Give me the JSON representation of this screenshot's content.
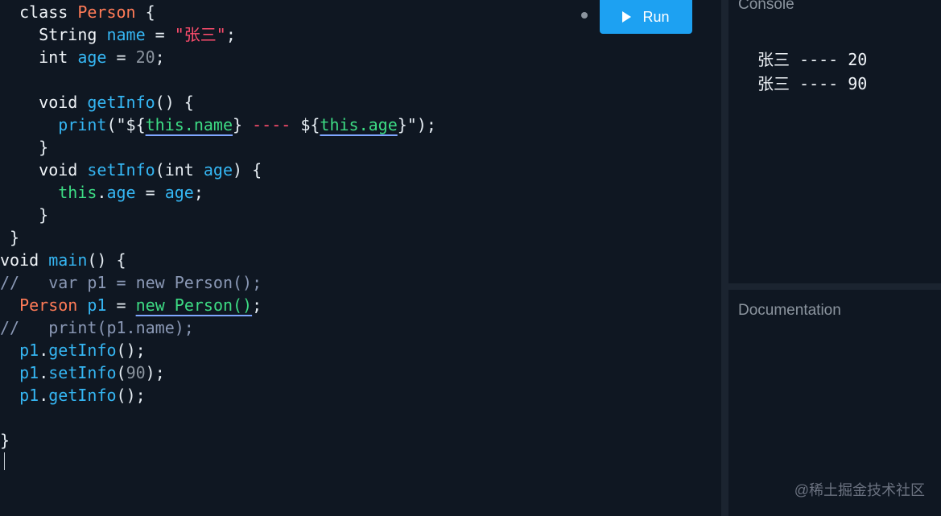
{
  "editor": {
    "lines": [
      [
        [
          "  class ",
          "kw"
        ],
        [
          "Person",
          "cls"
        ],
        [
          " {",
          "pn"
        ]
      ],
      [
        [
          "    String ",
          "kw"
        ],
        [
          "name",
          "id"
        ],
        [
          " = ",
          "pn"
        ],
        [
          "\"张三\"",
          "str"
        ],
        [
          ";",
          "pn"
        ]
      ],
      [
        [
          "    int ",
          "kw"
        ],
        [
          "age",
          "id"
        ],
        [
          " = ",
          "pn"
        ],
        [
          "20",
          "num"
        ],
        [
          ";",
          "pn"
        ]
      ],
      [
        [
          "",
          "pn"
        ]
      ],
      [
        [
          "    void ",
          "kw"
        ],
        [
          "getInfo",
          "id"
        ],
        [
          "() {",
          "pn"
        ]
      ],
      [
        [
          "      ",
          "pn"
        ],
        [
          "print",
          "id"
        ],
        [
          "(\"${",
          "pn"
        ],
        [
          "this.name",
          "th ul"
        ],
        [
          "} ",
          "pn"
        ],
        [
          "----",
          "str"
        ],
        [
          " ${",
          "pn"
        ],
        [
          "this.age",
          "th ul"
        ],
        [
          "}\");",
          "pn"
        ]
      ],
      [
        [
          "    }",
          "pn"
        ]
      ],
      [
        [
          "    void ",
          "kw"
        ],
        [
          "setInfo",
          "id"
        ],
        [
          "(int ",
          "pn"
        ],
        [
          "age",
          "id"
        ],
        [
          ") {",
          "pn"
        ]
      ],
      [
        [
          "      ",
          "pn"
        ],
        [
          "this",
          "th"
        ],
        [
          ".",
          "pn"
        ],
        [
          "age",
          "id"
        ],
        [
          " = ",
          "pn"
        ],
        [
          "age",
          "id"
        ],
        [
          ";",
          "pn"
        ]
      ],
      [
        [
          "    }",
          "pn"
        ]
      ],
      [
        [
          " }",
          "pn"
        ]
      ],
      [
        [
          "void ",
          "kw"
        ],
        [
          "main",
          "id"
        ],
        [
          "() {",
          "pn"
        ]
      ],
      [
        [
          "//   var p1 = new Person();",
          "cm"
        ]
      ],
      [
        [
          "  ",
          "pn"
        ],
        [
          "Person",
          "cls"
        ],
        [
          " ",
          "pn"
        ],
        [
          "p1",
          "id"
        ],
        [
          " = ",
          "pn"
        ],
        [
          "new Person()",
          "th ul"
        ],
        [
          ";",
          "pn"
        ]
      ],
      [
        [
          "//   print(p1.name);",
          "cm"
        ]
      ],
      [
        [
          "  ",
          "pn"
        ],
        [
          "p1",
          "id"
        ],
        [
          ".",
          "pn"
        ],
        [
          "getInfo",
          "id"
        ],
        [
          "();",
          "pn"
        ]
      ],
      [
        [
          "  ",
          "pn"
        ],
        [
          "p1",
          "id"
        ],
        [
          ".",
          "pn"
        ],
        [
          "setInfo",
          "id"
        ],
        [
          "(",
          "pn"
        ],
        [
          "90",
          "num"
        ],
        [
          ");",
          "pn"
        ]
      ],
      [
        [
          "  ",
          "pn"
        ],
        [
          "p1",
          "id"
        ],
        [
          ".",
          "pn"
        ],
        [
          "getInfo",
          "id"
        ],
        [
          "();",
          "pn"
        ]
      ],
      [
        [
          "",
          "pn"
        ]
      ],
      [
        [
          "}",
          "pn"
        ]
      ]
    ]
  },
  "toolbar": {
    "run_label": "Run",
    "play_icon": "play-icon"
  },
  "console": {
    "title": "Console",
    "lines": [
      "张三 ---- 20",
      "张三 ---- 90"
    ]
  },
  "documentation": {
    "title": "Documentation"
  },
  "watermark": "@稀土掘金技术社区",
  "colors": {
    "background": "#0f1722",
    "keyword": "#f1f5f9",
    "class": "#ff7b57",
    "identifier": "#35b6f3",
    "string": "#ff4d6d",
    "number": "#8b949e",
    "this": "#3ddc84",
    "comment": "#8a98b5",
    "run_button": "#1da1f2"
  }
}
